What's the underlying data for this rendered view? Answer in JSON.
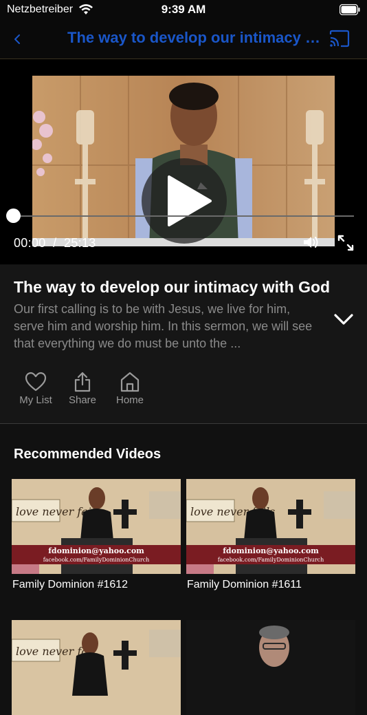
{
  "status_bar": {
    "carrier": "Netzbetreiber",
    "time": "9:39 AM",
    "wifi_icon": "wifi-icon",
    "battery_icon": "battery-icon"
  },
  "nav": {
    "back_icon": "chevron-left-icon",
    "title": "The way to develop our intimacy w...",
    "cast_icon": "cast-icon",
    "title_color": "#1a56c8"
  },
  "player": {
    "current_time": "00:00",
    "separator": "/",
    "duration": "25:13",
    "time_display": "00:00  /  25:13",
    "progress": 0,
    "play_icon": "play-icon",
    "volume_icon": "volume-icon",
    "fullscreen_icon": "fullscreen-icon"
  },
  "video": {
    "title": "The way to develop our intimacy with God",
    "description_lines": [
      "Our first calling is to be with Jesus, we live for him,",
      "serve him and worship him. In this sermon, we will see",
      "that everything we do must be unto the ..."
    ],
    "expand_icon": "chevron-down-icon"
  },
  "actions": [
    {
      "label": "My List",
      "icon": "heart-icon"
    },
    {
      "label": "Share",
      "icon": "share-icon"
    },
    {
      "label": "Home",
      "icon": "home-icon"
    }
  ],
  "recommended": {
    "heading": "Recommended Videos",
    "items": [
      {
        "title": "Family Dominion #1612",
        "banner_line1": "fdominion@yahoo.com",
        "banner_line2": "facebook.com/FamilyDominionChurch",
        "sign": "love never fails"
      },
      {
        "title": "Family Dominion #1611",
        "banner_line1": "fdominion@yahoo.com",
        "banner_line2": "facebook.com/FamilyDominionChurch",
        "sign": "love never fails"
      },
      {
        "title": "",
        "sign": "love never fai"
      },
      {
        "title": ""
      }
    ]
  }
}
